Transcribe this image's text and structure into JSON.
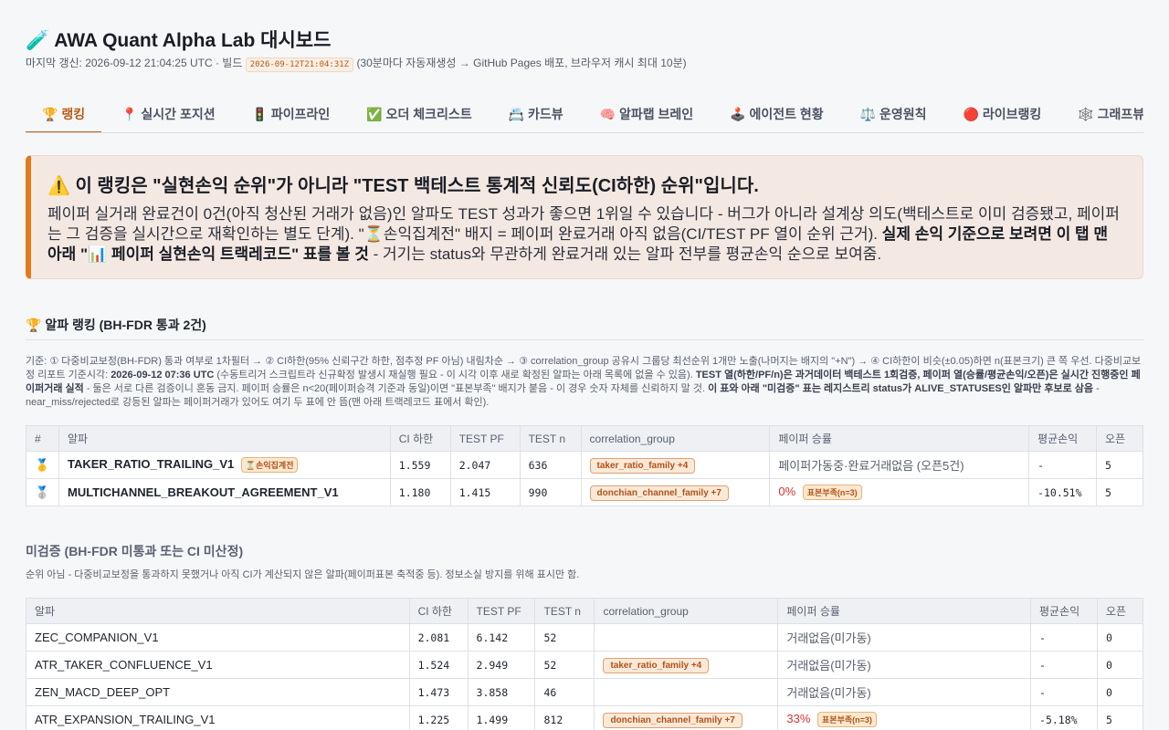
{
  "header": {
    "title": "🧪 AWA Quant Alpha Lab 대시보드",
    "meta_prefix": "마지막 갱신: 2026-09-12 21:04:25 UTC · 빌드",
    "build_id": "2026-09-12T21:04:31Z",
    "meta_suffix": "(30분마다 자동재생성 → GitHub Pages 배포, 브라우저 캐시 최대 10분)"
  },
  "tabs": [
    {
      "label": "🏆 랭킹",
      "active": true
    },
    {
      "label": "📍 실시간 포지션"
    },
    {
      "label": "🚦 파이프라인"
    },
    {
      "label": "✅ 오더 체크리스트"
    },
    {
      "label": "📇 카드뷰"
    },
    {
      "label": "🧠 알파랩 브레인"
    },
    {
      "label": "🕹️ 에이전트 현황"
    },
    {
      "label": "⚖️ 운영원칙"
    },
    {
      "label": "🔴 라이브랭킹"
    },
    {
      "label": "🕸️ 그래프뷰"
    }
  ],
  "warning": {
    "title": "⚠️ 이 랭킹은 \"실현손익 순위\"가 아니라 \"TEST 백테스트 통계적 신뢰도(CI하한) 순위\"입니다.",
    "body_1": "페이퍼 실거래 완료건이 0건(아직 청산된 거래가 없음)인 알파도 TEST 성과가 좋으면 1위일 수 있습니다 - 버그가 아니라 설계상 의도(백테스트로 이미 검증됐고, 페이퍼는 그 검증을 실시간으로 재확인하는 별도 단계). \"⏳손익집계전\" 배지 = 페이퍼 완료거래 아직 없음(CI/TEST PF 열이 순위 근거). ",
    "body_bold": "실제 손익 기준으로 보려면 이 탭 맨 아래 \"📊 페이퍼 실현손익 트랙레코드\" 표를 볼 것",
    "body_2": " - 거기는 status와 무관하게 완료거래 있는 알파 전부를 평균손익 순으로 보여줌."
  },
  "ranking": {
    "title": "🏆 알파 랭킹 (BH-FDR 통과 2건)",
    "note_1": "기준: ① 다중비교보정(BH-FDR) 통과 여부로 1차필터 → ② CI하한(95% 신뢰구간 하한, 점추정 PF 아님) 내림차순 → ③ correlation_group 공유시 그룹당 최선순위 1개만 노출(나머지는 배지의 \"+N\") → ④ CI하한이 비슷(±0.05)하면 n(표본크기) 큰 쪽 우선. 다중비교보정 리포트 기준시각: ",
    "note_time": "2026-09-12 07:36 UTC",
    "note_2": " (수동트리거 스크립트라 신규확정 발생시 재실행 필요 - 이 시각 이후 새로 확정된 알파는 아래 목록에 없을 수 있음). ",
    "note_b1": "TEST 열(하한/PF/n)은 과거데이터 백테스트 1회검증, 페이퍼 열(승률/평균손익/오픈)은 실시간 진행중인 페이퍼거래 실적",
    "note_3": " - 둘은 서로 다른 검증이니 혼동 금지. 페이퍼 승률은 n<20(페이퍼승격 기준과 동일)이면 \"표본부족\" 배지가 붙음 - 이 경우 숫자 자체를 신뢰하지 말 것. ",
    "note_b2": "이 표와 아래 \"미검증\" 표는 레지스트리 status가 ALIVE_STATUSES인 알파만 후보로 삼음",
    "note_4": " - near_miss/rejected로 강등된 알파는 페이퍼거래가 있어도 여기 두 표에 안 뜸(맨 아래 트랙레코드 표에서 확인).",
    "headers": [
      "#",
      "알파",
      "CI 하한",
      "TEST PF",
      "TEST n",
      "correlation_group",
      "페이퍼 승률",
      "평균손익",
      "오픈"
    ],
    "rows": [
      {
        "rank": "🥇",
        "alpha": "TAKER_RATIO_TRAILING_V1",
        "alpha_badge": "⏳손익집계전",
        "ci": "1.559",
        "pf": "2.047",
        "n": "636",
        "group": "taker_ratio_family +4",
        "winrate": "페이퍼가동중·완료거래없음 (오픈5건)",
        "winrate_badge": "",
        "avg": "-",
        "open": "5"
      },
      {
        "rank": "🥈",
        "alpha": "MULTICHANNEL_BREAKOUT_AGREEMENT_V1",
        "alpha_badge": "",
        "ci": "1.180",
        "pf": "1.415",
        "n": "990",
        "group": "donchian_channel_family +7",
        "winrate": "0%",
        "winrate_badge": "표본부족(n=3)",
        "avg": "-10.51%",
        "open": "5"
      }
    ]
  },
  "unverified": {
    "title": "미검증 (BH-FDR 미통과 또는 CI 미산정)",
    "note": "순위 아님 - 다중비교보정을 통과하지 못했거나 아직 CI가 계산되지 않은 알파(페이퍼표본 축적중 등). 정보소실 방지를 위해 표시만 함.",
    "headers": [
      "알파",
      "CI 하한",
      "TEST PF",
      "TEST n",
      "correlation_group",
      "페이퍼 승률",
      "평균손익",
      "오픈"
    ],
    "rows": [
      {
        "alpha": "ZEC_COMPANION_V1",
        "ci": "2.081",
        "pf": "6.142",
        "n": "52",
        "group": "",
        "winrate": "거래없음(미가동)",
        "winrate_badge": "",
        "avg": "-",
        "open": "0"
      },
      {
        "alpha": "ATR_TAKER_CONFLUENCE_V1",
        "ci": "1.524",
        "pf": "2.949",
        "n": "52",
        "group": "taker_ratio_family +4",
        "winrate": "거래없음(미가동)",
        "winrate_badge": "",
        "avg": "-",
        "open": "0"
      },
      {
        "alpha": "ZEN_MACD_DEEP_OPT",
        "ci": "1.473",
        "pf": "3.858",
        "n": "46",
        "group": "",
        "winrate": "거래없음(미가동)",
        "winrate_badge": "",
        "avg": "-",
        "open": "0"
      },
      {
        "alpha": "ATR_EXPANSION_TRAILING_V1",
        "ci": "1.225",
        "pf": "1.499",
        "n": "812",
        "group": "donchian_channel_family +7",
        "winrate": "33%",
        "winrate_badge": "표본부족(n=3)",
        "avg": "-5.18%",
        "open": "5"
      }
    ]
  }
}
